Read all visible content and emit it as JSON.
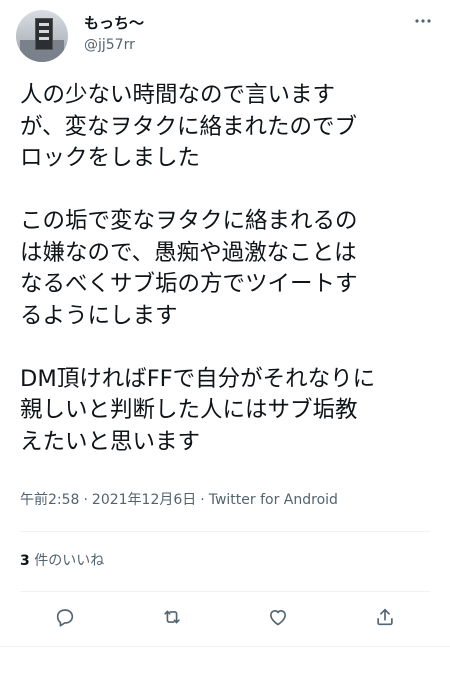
{
  "user": {
    "display_name": "もっち〜",
    "handle": "@jj57rr"
  },
  "icons": {
    "more": "more-horizontal-icon",
    "reply": "reply-icon",
    "retweet": "retweet-icon",
    "like": "heart-icon",
    "share": "share-icon"
  },
  "tweet": {
    "lines": [
      "人の少ない時間なので言います",
      "が、変なヲタクに絡まれたのでブ",
      "ロックをしました",
      "",
      "この垢で変なヲタクに絡まれるの",
      "は嫌なので、愚痴や過激なことは",
      "なるべくサブ垢の方でツイートす",
      "るようにします",
      "",
      "DM頂ければFFで自分がそれなりに",
      "親しいと判断した人にはサブ垢教",
      "えたいと思います"
    ],
    "time": "午前2:58",
    "date": "2021年12月6日",
    "separator": "·",
    "source": "Twitter for Android"
  },
  "stats": {
    "like_count": "3",
    "like_label": "件のいいね"
  },
  "colors": {
    "text": "#0f1419",
    "secondary": "#536471",
    "divider": "#eff3f4"
  }
}
